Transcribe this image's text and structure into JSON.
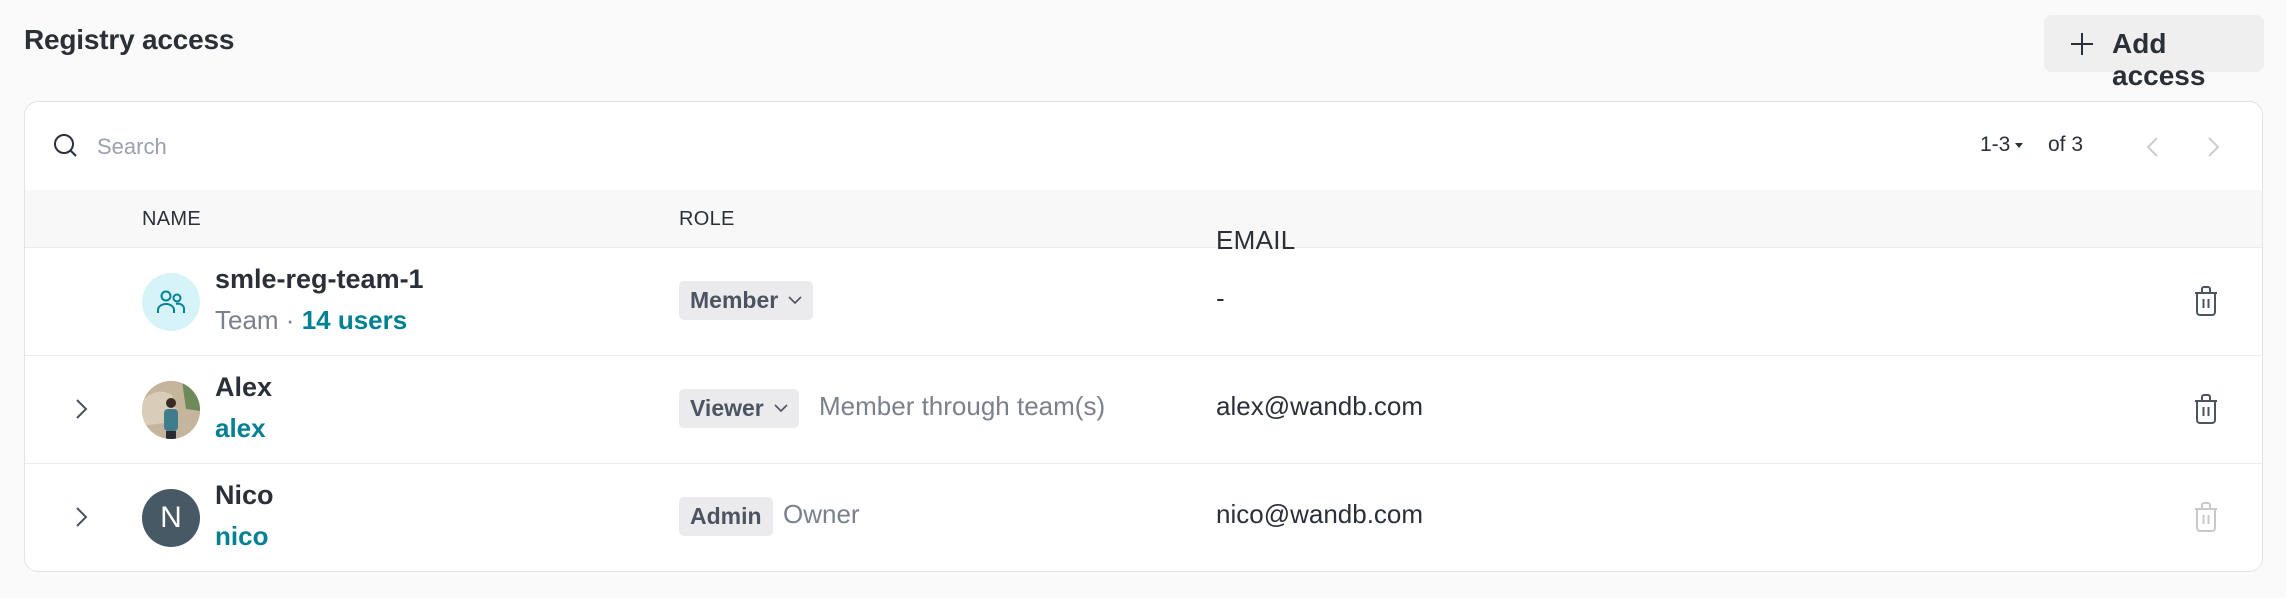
{
  "page": {
    "title": "Registry access",
    "add_button_label": "Add access"
  },
  "toolbar": {
    "search_placeholder": "Search",
    "search_value": "",
    "pager_range": "1-3",
    "pager_total": "of 3"
  },
  "table": {
    "columns": [
      "NAME",
      "ROLE",
      "EMAIL"
    ],
    "rows": [
      {
        "type": "team",
        "name": "smle-reg-team-1",
        "subtitle_prefix": "Team · ",
        "subtitle_link": "14 users",
        "role": "Member",
        "role_editable": true,
        "role_note": "",
        "email": "-",
        "avatar": "team-icon",
        "delete_enabled": true
      },
      {
        "type": "user",
        "name": "Alex",
        "username": "alex",
        "role": "Viewer",
        "role_editable": true,
        "role_note": "Member through team(s)",
        "email": "alex@wandb.com",
        "avatar": "photo",
        "delete_enabled": true
      },
      {
        "type": "user",
        "name": "Nico",
        "username": "nico",
        "avatar_initial": "N",
        "role": "Admin",
        "role_editable": false,
        "role_note": "Owner",
        "email": "nico@wandb.com",
        "avatar": "initial",
        "delete_enabled": false
      }
    ]
  },
  "colors": {
    "accent_teal": "#038194",
    "team_avatar_bg": "#d6f4f8",
    "initial_avatar_bg": "#465965",
    "pill_bg": "#ebebee",
    "delete_disabled": "#c7c9cd"
  }
}
